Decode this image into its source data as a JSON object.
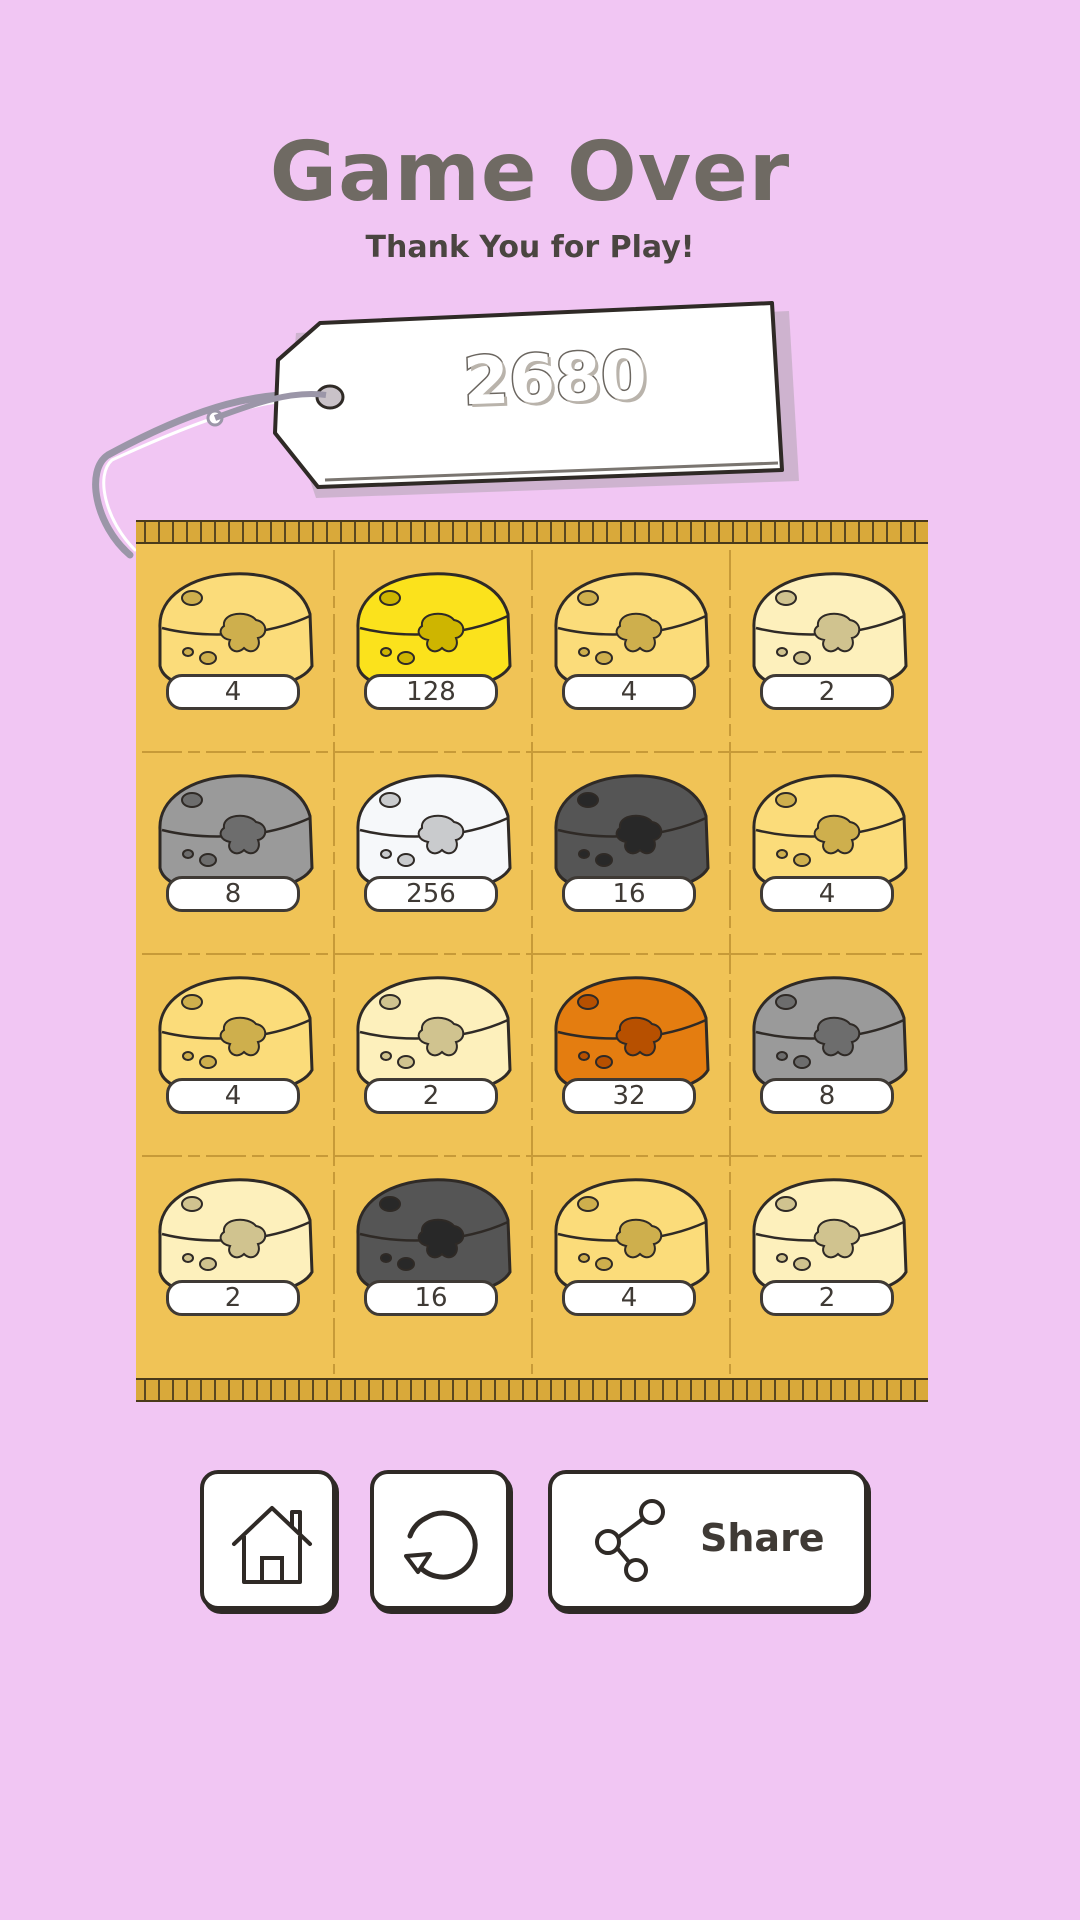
{
  "header": {
    "title": "Game Over",
    "subtitle": "Thank You for Play!"
  },
  "score": "2680",
  "board": {
    "tiles": [
      {
        "value": "4",
        "color": "#fbdc7a"
      },
      {
        "value": "128",
        "color": "#fbe21c"
      },
      {
        "value": "4",
        "color": "#fbdc7a"
      },
      {
        "value": "2",
        "color": "#fdf0bc"
      },
      {
        "value": "8",
        "color": "#9a9a9a"
      },
      {
        "value": "256",
        "color": "#f6f8fa"
      },
      {
        "value": "16",
        "color": "#555555"
      },
      {
        "value": "4",
        "color": "#fbdc7a"
      },
      {
        "value": "4",
        "color": "#fbdc7a"
      },
      {
        "value": "2",
        "color": "#fdf0bc"
      },
      {
        "value": "32",
        "color": "#e47d10"
      },
      {
        "value": "8",
        "color": "#9a9a9a"
      },
      {
        "value": "2",
        "color": "#fdf0bc"
      },
      {
        "value": "16",
        "color": "#555555"
      },
      {
        "value": "4",
        "color": "#fbdc7a"
      },
      {
        "value": "2",
        "color": "#fdf0bc"
      }
    ]
  },
  "buttons": {
    "home_icon": "home-icon",
    "replay_icon": "replay-icon",
    "share_icon": "share-icon",
    "share_label": "Share"
  },
  "colors": {
    "background": "#f1c6f3",
    "board": "#f0c356",
    "text": "#6f6a63"
  }
}
